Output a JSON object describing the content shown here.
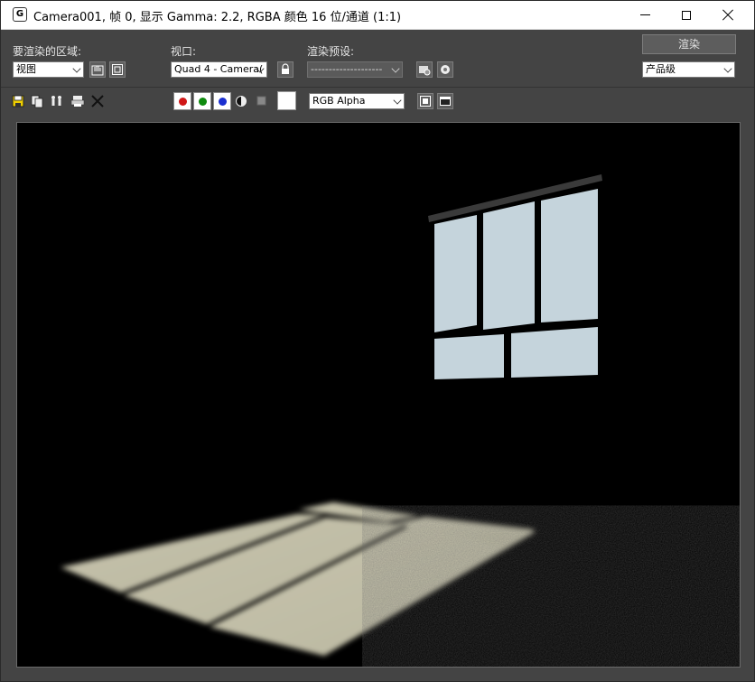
{
  "window": {
    "title": "Camera001, 帧 0, 显示 Gamma: 2.2, RGBA 颜色 16 位/通道 (1:1)",
    "app_icon_glyph": "G"
  },
  "area": {
    "label": "要渲染的区域:",
    "value": "视图"
  },
  "viewport": {
    "label": "视口:",
    "value": "Quad 4 - Camera("
  },
  "preset": {
    "label": "渲染预设:",
    "value": "--------------------"
  },
  "render": {
    "button_label": "渲染",
    "quality_value": "产品级"
  },
  "channel": {
    "value": "RGB Alpha"
  },
  "colors": {
    "red": "#d01818",
    "green": "#0e8a0e",
    "blue": "#1a2fd0",
    "window_glass": "#c5d4dc",
    "floor_light": "#c9c6af"
  }
}
